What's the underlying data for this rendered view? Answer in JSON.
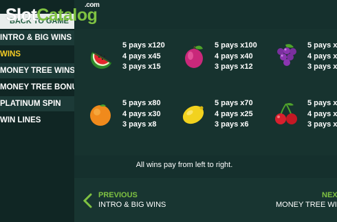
{
  "watermark": {
    "slot": "Slot",
    "catalog": "Catalog",
    "com": ".com"
  },
  "sidebar": {
    "back_label": "BACK TO GAME",
    "items": [
      {
        "label": "INTRO & BIG WINS"
      },
      {
        "label": "WINS"
      },
      {
        "label": "MONEY TREE WINS"
      },
      {
        "label": "MONEY TREE BONUS FREE SPINS"
      },
      {
        "label": "PLATINUM SPIN"
      },
      {
        "label": "WIN LINES"
      }
    ]
  },
  "paytable": [
    {
      "symbol": "watermelon-icon",
      "lines": [
        "5 pays x120",
        "4 pays x45",
        "3 pays x15"
      ]
    },
    {
      "symbol": "plum-icon",
      "lines": [
        "5 pays x100",
        "4 pays x40",
        "3 pays x12"
      ]
    },
    {
      "symbol": "grapes-icon",
      "lines": [
        "5 pays x",
        "4 pays x",
        "3 pays x"
      ]
    },
    {
      "symbol": "orange-icon",
      "lines": [
        "5 pays x80",
        "4 pays x30",
        "3 pays x8"
      ]
    },
    {
      "symbol": "lemon-icon",
      "lines": [
        "5 pays x70",
        "4 pays x25",
        "3 pays x6"
      ]
    },
    {
      "symbol": "cherries-icon",
      "lines": [
        "5 pays x",
        "4 pays x",
        "3 pays x"
      ]
    }
  ],
  "note": "All wins pay from left to right.",
  "nav": {
    "prev_title": "PREVIOUS",
    "prev_sub": "INTRO & BIG WINS",
    "next_title": "NEXT",
    "next_sub": "MONEY TREE WINS"
  },
  "colors": {
    "background": "#15302d",
    "sidebar": "#102624",
    "active": "#f5cc24",
    "accent_green": "#7fc242"
  }
}
